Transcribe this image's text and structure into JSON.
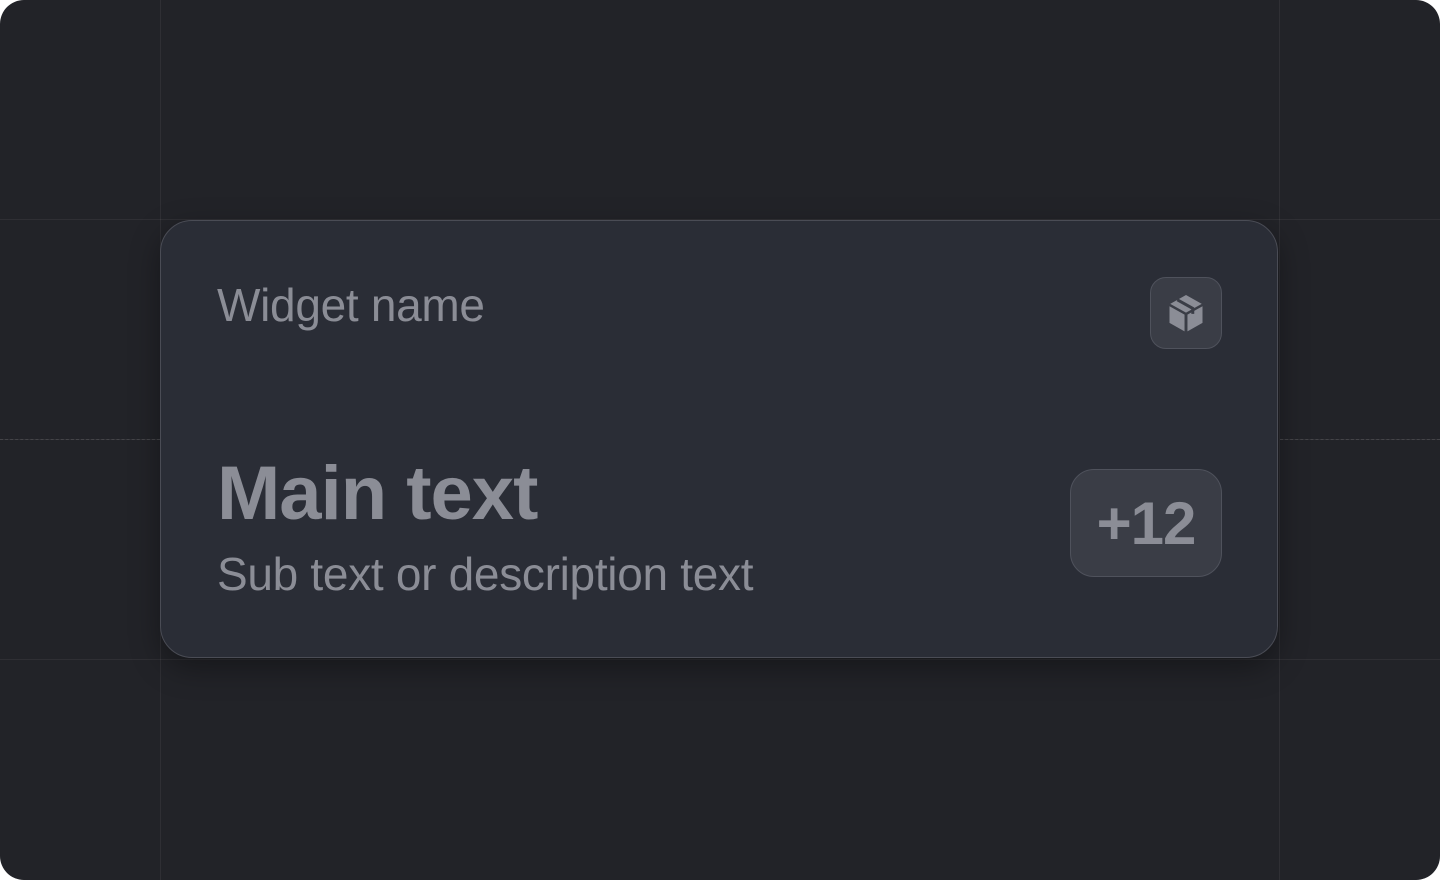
{
  "widget": {
    "name": "Widget name",
    "icon": "cube-icon",
    "main_text": "Main text",
    "sub_text": "Sub text or description text",
    "badge": "+12"
  },
  "colors": {
    "background": "#222328",
    "card": "#2a2d36",
    "card_border": "#4a4c55",
    "text": "#8b8d96",
    "badge_bg": "#3a3d46"
  }
}
